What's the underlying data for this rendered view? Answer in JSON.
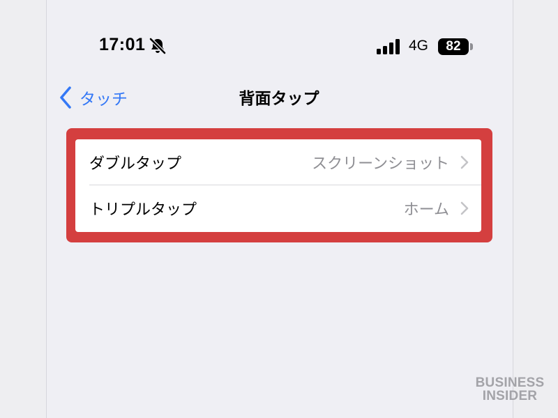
{
  "status_bar": {
    "time": "17:01",
    "network": "4G",
    "battery": "82"
  },
  "nav": {
    "back_label": "タッチ",
    "title": "背面タップ"
  },
  "settings_list": [
    {
      "label": "ダブルタップ",
      "value": "スクリーンショット"
    },
    {
      "label": "トリプルタップ",
      "value": "ホーム"
    }
  ],
  "watermark": {
    "line1": "BUSINESS",
    "line2": "INSIDER"
  },
  "colors": {
    "accent": "#3478f6",
    "highlight": "#d43f3f",
    "background": "#efeff4",
    "secondary_text": "#8e8e93"
  },
  "icons": {
    "silent": "bell-slash-icon",
    "signal": "cellular-signal-icon",
    "back": "chevron-left-icon",
    "disclosure": "chevron-right-icon"
  }
}
